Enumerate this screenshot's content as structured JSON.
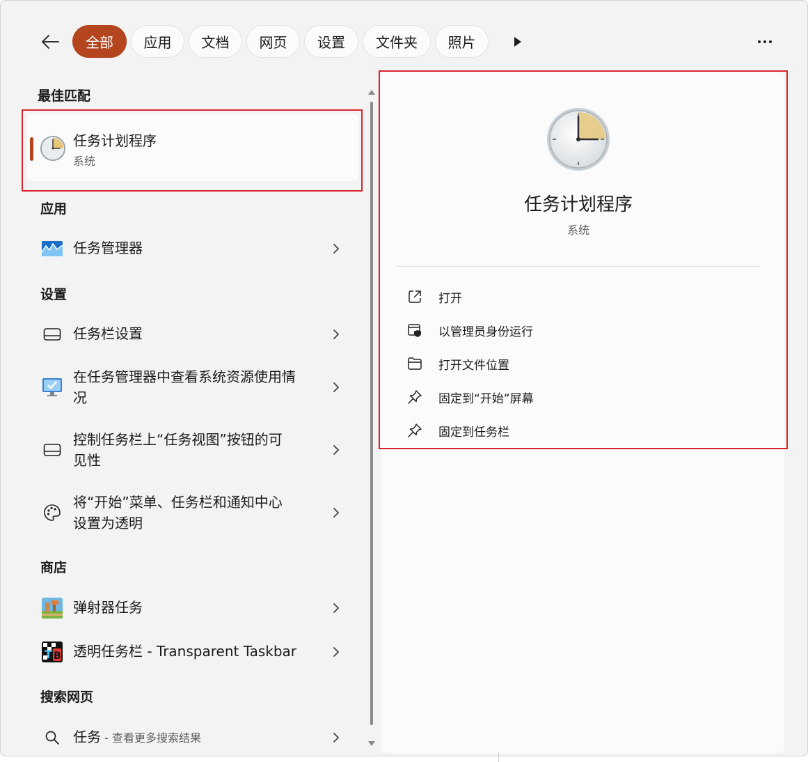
{
  "filters": {
    "tabs": [
      {
        "label": "全部",
        "active": true
      },
      {
        "label": "应用",
        "active": false
      },
      {
        "label": "文档",
        "active": false
      },
      {
        "label": "网页",
        "active": false
      },
      {
        "label": "设置",
        "active": false
      },
      {
        "label": "文件夹",
        "active": false
      },
      {
        "label": "照片",
        "active": false
      }
    ]
  },
  "best_match": {
    "heading": "最佳匹配",
    "title": "任务计划程序",
    "subtitle": "系统",
    "icon": "clock-icon"
  },
  "apps": {
    "heading": "应用",
    "items": [
      {
        "label": "任务管理器",
        "icon": "task-manager-icon"
      }
    ]
  },
  "settings": {
    "heading": "设置",
    "items": [
      {
        "label": "任务栏设置",
        "icon": "taskbar-icon"
      },
      {
        "label": "在任务管理器中查看系统资源使用情况",
        "icon": "monitor-check-icon"
      },
      {
        "label": "控制任务栏上“任务视图”按钮的可见性",
        "icon": "taskbar-icon"
      },
      {
        "label": "将“开始”菜单、任务栏和通知中心设置为透明",
        "icon": "palette-icon"
      }
    ]
  },
  "store": {
    "heading": "商店",
    "items": [
      {
        "label": "弹射器任务",
        "icon": "game-icon"
      },
      {
        "label": "透明任务栏 - Transparent Taskbar",
        "icon": "tb-app-icon"
      }
    ]
  },
  "web": {
    "heading": "搜索网页",
    "query": "任务",
    "hint": " - 查看更多搜索结果",
    "icon": "search-icon"
  },
  "detail": {
    "title": "任务计划程序",
    "subtitle": "系统",
    "actions": [
      {
        "label": "打开",
        "icon": "open-external-icon"
      },
      {
        "label": "以管理员身份运行",
        "icon": "admin-shield-icon"
      },
      {
        "label": "打开文件位置",
        "icon": "folder-icon"
      },
      {
        "label": "固定到“开始”屏幕",
        "icon": "pin-icon"
      },
      {
        "label": "固定到任务栏",
        "icon": "pin-icon"
      }
    ]
  },
  "colors": {
    "accent": "#b4451f",
    "highlight": "#d9232e",
    "pane": "#fbfbfb",
    "background": "#f3f3f3"
  }
}
